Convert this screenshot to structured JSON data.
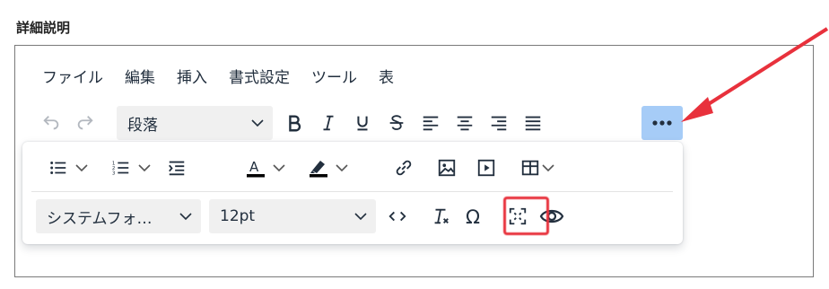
{
  "field": {
    "label": "詳細説明"
  },
  "menubar": {
    "items": [
      "ファイル",
      "編集",
      "挿入",
      "書式設定",
      "ツール",
      "表"
    ]
  },
  "toolbar": {
    "block_format": "段落",
    "more_icon": "more-horizontal-icon",
    "accent_color": "#a6ccf7"
  },
  "overflow": {
    "font_family": "システムフォ…",
    "font_size": "12pt",
    "text_color": "#000000",
    "highlight_color": "#000000"
  },
  "annotation": {
    "color": "#e8313c",
    "arrow_color": "#e8313c"
  }
}
